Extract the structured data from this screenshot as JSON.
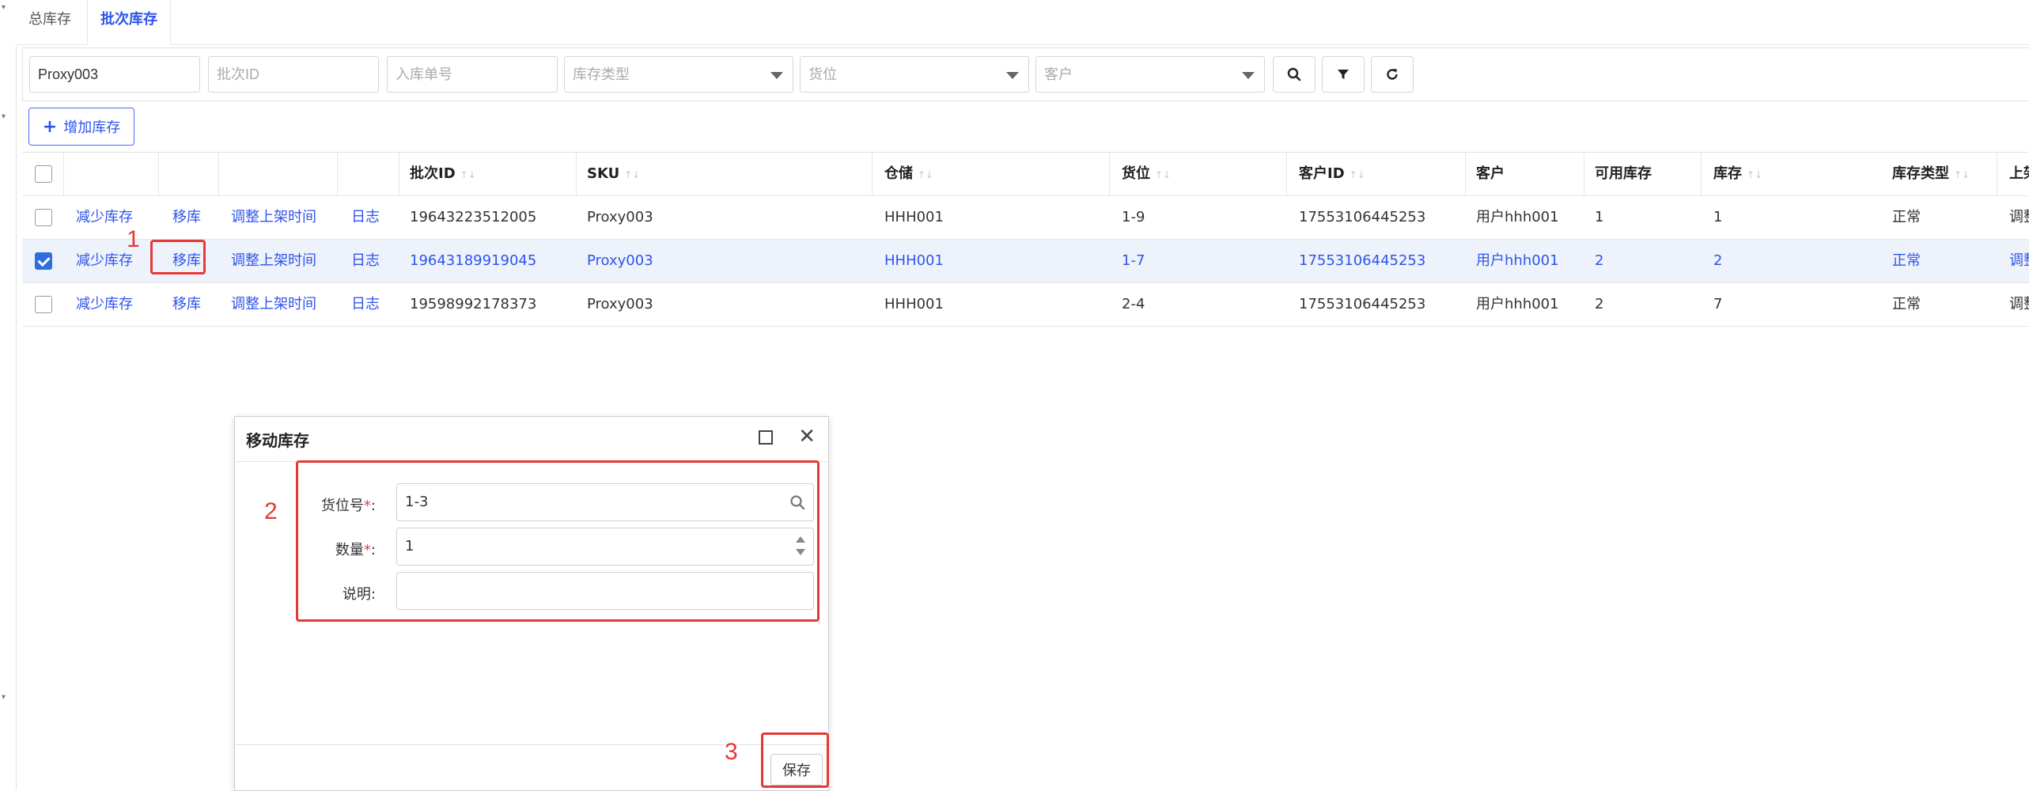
{
  "tabs": [
    {
      "label": "总库存"
    },
    {
      "label": "批次库存"
    }
  ],
  "filters": {
    "sku_value": "Proxy003",
    "batch_id_placeholder": "批次ID",
    "inbound_no_placeholder": "入库单号",
    "stock_type_placeholder": "库存类型",
    "location_placeholder": "货位",
    "customer_placeholder": "客户"
  },
  "toolbar": {
    "add_label": "增加库存"
  },
  "table": {
    "headers": [
      "批次ID",
      "SKU",
      "仓储",
      "货位",
      "客户ID",
      "客户",
      "可用库存",
      "库存",
      "库存类型",
      "上架"
    ],
    "rows": [
      {
        "checked": false,
        "actions": [
          "减少库存",
          "移库",
          "调整上架时间",
          "日志"
        ],
        "batch_id": "19643223512005",
        "sku": "Proxy003",
        "warehouse": "HHH001",
        "location": "1-9",
        "customer_id": "17553106445253",
        "customer": "用户hhh001",
        "available": "1",
        "stock": "1",
        "type": "正常",
        "tail": "调整"
      },
      {
        "checked": true,
        "actions": [
          "减少库存",
          "移库",
          "调整上架时间",
          "日志"
        ],
        "batch_id": "19643189919045",
        "sku": "Proxy003",
        "warehouse": "HHH001",
        "location": "1-7",
        "customer_id": "17553106445253",
        "customer": "用户hhh001",
        "available": "2",
        "stock": "2",
        "type": "正常",
        "tail": "调整"
      },
      {
        "checked": false,
        "actions": [
          "减少库存",
          "移库",
          "调整上架时间",
          "日志"
        ],
        "batch_id": "19598992178373",
        "sku": "Proxy003",
        "warehouse": "HHH001",
        "location": "2-4",
        "customer_id": "17553106445253",
        "customer": "用户hhh001",
        "available": "2",
        "stock": "7",
        "type": "正常",
        "tail": "调整"
      }
    ]
  },
  "dialog": {
    "title": "移动库存",
    "location_label": "货位号",
    "location_value": "1-3",
    "quantity_label": "数量",
    "quantity_value": "1",
    "note_label": "说明",
    "required_mark": "*",
    "colon": ":",
    "save_label": "保存"
  },
  "annotations": [
    "1",
    "2",
    "3"
  ],
  "colors": {
    "accent": "#2f54eb",
    "annotation": "#e53935",
    "selected_row": "#eef3fb"
  }
}
